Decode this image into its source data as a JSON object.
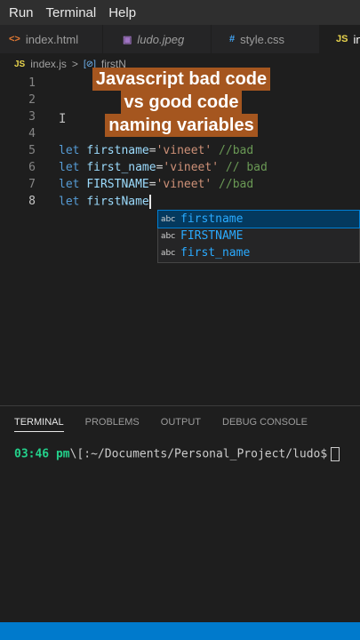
{
  "menu": [
    "Run",
    "Terminal",
    "Help"
  ],
  "tabs": [
    {
      "icon": "<>",
      "label": "index.html"
    },
    {
      "icon": "▣",
      "label": "ludo.jpeg"
    },
    {
      "icon": "#",
      "label": "style.css"
    },
    {
      "icon": "JS",
      "label": "in"
    }
  ],
  "breadcrumb": {
    "icon": "JS",
    "file": "index.js",
    "sep": ">",
    "symbol_icon": "[⊘]",
    "symbol": "firstN"
  },
  "overlay": [
    "Javascript bad code",
    "vs good code",
    "naming variables"
  ],
  "lines": [
    {
      "n": "1"
    },
    {
      "n": "2"
    },
    {
      "n": "3"
    },
    {
      "n": "4"
    },
    {
      "n": "5",
      "kw": "let",
      "var": "firstname",
      "op": "=",
      "str": "'vineet'",
      "cm": " //bad"
    },
    {
      "n": "6",
      "kw": "let",
      "var": "first_name",
      "op": "=",
      "str": "'vineet'",
      "cm": " // bad"
    },
    {
      "n": "7",
      "kw": "let",
      "var": "FIRSTNAME",
      "op": "=",
      "str": "'vineet'",
      "cm": " //bad"
    },
    {
      "n": "8",
      "kw": "let",
      "var": "firstName"
    }
  ],
  "suggestions": [
    {
      "kind": "abc",
      "label": "firstname"
    },
    {
      "kind": "abc",
      "label": "FIRSTNAME"
    },
    {
      "kind": "abc",
      "label": "first_name"
    }
  ],
  "panel_tabs": [
    "TERMINAL",
    "PROBLEMS",
    "OUTPUT",
    "DEBUG CONSOLE"
  ],
  "terminal": {
    "time": "03:46 pm",
    "path": "\\[:~/Documents/Personal_Project/ludo$"
  },
  "colors": {
    "accent": "#007acc",
    "overlay_bg": "#a5561f",
    "keyword": "#569cd6",
    "string": "#ce9178",
    "comment": "#6a9955"
  }
}
